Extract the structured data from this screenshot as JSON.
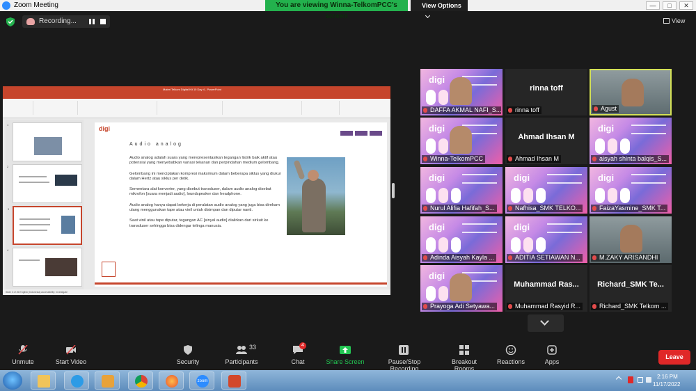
{
  "window": {
    "title": "Zoom Meeting",
    "viewing_banner": "You are viewing Winna-TelkomPCC's screen",
    "view_options": "View Options",
    "min_label": "—",
    "max_label": "□",
    "close_label": "✕"
  },
  "topbar": {
    "recording_label": "Recording...",
    "view_label": "View"
  },
  "shared_screen": {
    "ppt_title": "Materi Telkom Digital Kit 10 Day 4  -  PowerPoint",
    "ppt_tabs": [
      "File",
      "Home",
      "Insert",
      "Design",
      "Transitions",
      "Animations",
      "Slide Show",
      "Review",
      "View",
      "Help"
    ],
    "thumb_numbers": [
      "1",
      "2",
      "3",
      "4"
    ],
    "slide": {
      "brand": "digi",
      "title": "Audio analog",
      "paragraphs": [
        "Audio analog adalah suara yang merepresentasikan tegangan listrik baik aktif atau potensial yang menyebabkan variasi tekanan dan perpindahan medium gelombang.",
        "Gelombang ini menciptakan kompresi maksimum dalam beberapa siklus yang diukur dalam Hertz atau siklus per detik.",
        "Sementara alat konverter, yang disebut transduser, dalam audio analog disebut mikrofon [suara menjadi audio], loundspeaker dan headphone.",
        "Audio analog hanya dapat bekerja di peralatan audio analog yang juga bisa direkam ulang menggunakan tape atau vinil untuk disimpan dan diputar nanti.",
        "Saat vinil atau tape diputar, tegangan AC [sinyal audio] dialirkan dari sirkuit ke transduser sehingga bisa didengar telinga manusia."
      ]
    },
    "status_text": "Slide 3 of 26   English (Indonesia)   Accessibility: Investigate"
  },
  "participants": [
    {
      "name": "DAFFA AKMAL NAFI_S...",
      "type": "video-digi"
    },
    {
      "name": "rinna toff",
      "display": "rinna toff",
      "type": "name"
    },
    {
      "name": "Agust",
      "type": "video-cam"
    },
    {
      "name": "Winna-TelkomPCC",
      "type": "video-digi"
    },
    {
      "name": "Ahmad Ihsan M",
      "display": "Ahmad Ihsan M",
      "type": "name"
    },
    {
      "name": "aisyah shinta balqis_S...",
      "type": "video-digi"
    },
    {
      "name": "Nurul Alifia Hafifah_S...",
      "type": "video-digi"
    },
    {
      "name": "Nafhisa_SMK TELKO...",
      "type": "video-digi"
    },
    {
      "name": "FaizaYasmine_SMK T...",
      "type": "video-digi"
    },
    {
      "name": "Adinda Aisyah Kayla ...",
      "type": "video-digi"
    },
    {
      "name": "ADITIA SETIAWAN N...",
      "type": "video-digi"
    },
    {
      "name": "M.ZAKY ARISANDHI",
      "type": "video-cam"
    },
    {
      "name": "Prayoga Adi Setyawa...",
      "type": "video-digi"
    },
    {
      "name": "Muhammad Rasyid R...",
      "display": "Muhammad Ras...",
      "type": "name"
    },
    {
      "name": "Richard_SMK Telkom ...",
      "display": "Richard_SMK Te...",
      "type": "name"
    }
  ],
  "toolbar": {
    "unmute": "Unmute",
    "start_video": "Start Video",
    "security": "Security",
    "participants": "Participants",
    "participants_count": "33",
    "chat": "Chat",
    "chat_badge": "4",
    "share_screen": "Share Screen",
    "pause_stop_recording": "Pause/Stop Recording",
    "breakout_rooms": "Breakout Rooms",
    "reactions": "Reactions",
    "apps": "Apps",
    "leave": "Leave"
  },
  "taskbar": {
    "time": "2:16 PM",
    "date": "11/17/2022",
    "zoom_label": "zoom"
  },
  "colors": {
    "banner_green": "#23b14d",
    "leave_red": "#e02828",
    "active_speaker": "#d4e157",
    "ppt_red": "#c6452c"
  }
}
